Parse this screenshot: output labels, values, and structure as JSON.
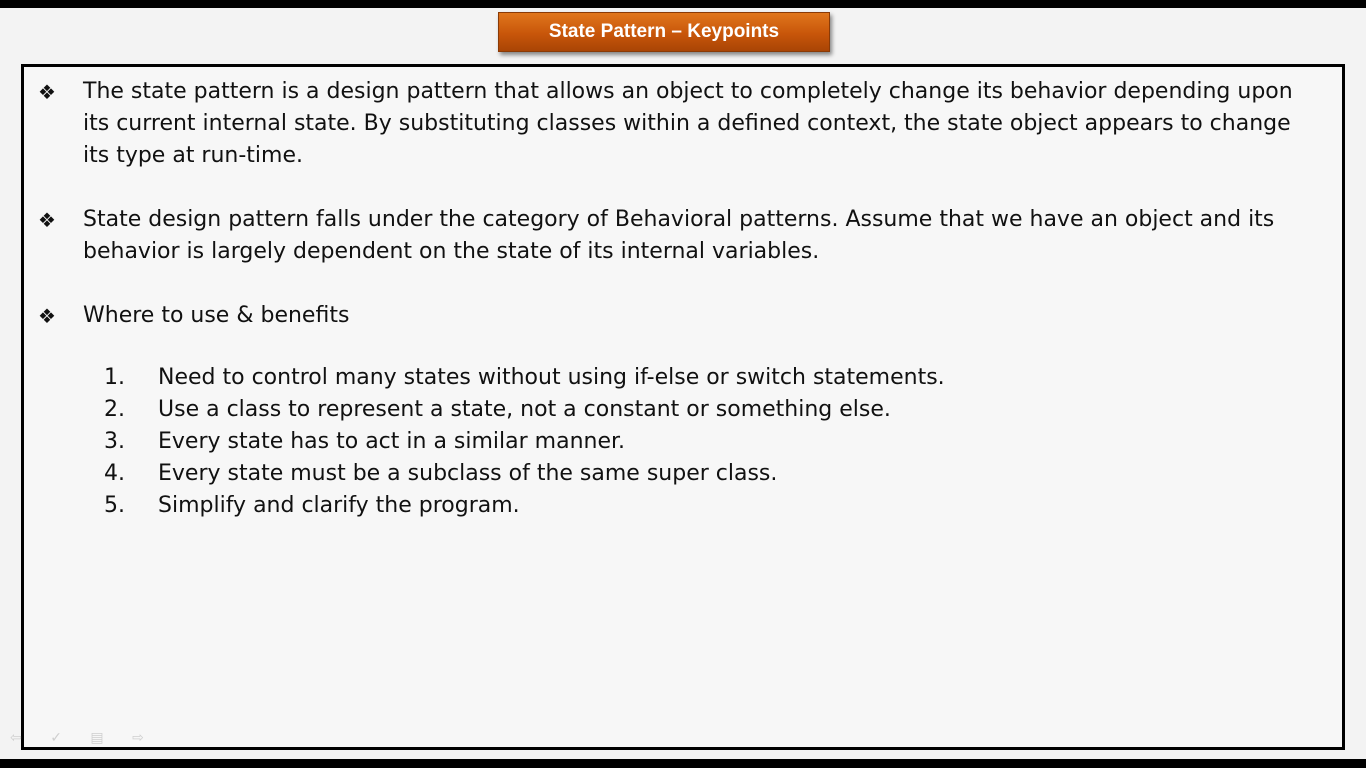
{
  "slide": {
    "title": "State Pattern – Keypoints",
    "bullet_symbol": "❖",
    "bullets": [
      {
        "text": "The state pattern is a design pattern that allows an object to completely change its behavior depending upon its current internal state. By substituting classes within a defined context, the state object appears to change its type at run-time."
      },
      {
        "text": "State design pattern falls under the category of Behavioral patterns. Assume that we have an object and its behavior is largely dependent on the state of its internal variables."
      },
      {
        "text": "Where to use & benefits"
      }
    ],
    "numbered": [
      {
        "num": "1.",
        "text": "Need to control many states without using if-else or switch statements."
      },
      {
        "num": "2.",
        "text": "Use a class to represent a state, not a constant or something else."
      },
      {
        "num": "3.",
        "text": "Every state has to act in a similar manner."
      },
      {
        "num": "4.",
        "text": "Every state must be a subclass of the same super class."
      },
      {
        "num": "5.",
        "text": "Simplify and clarify the program."
      }
    ]
  },
  "nav": {
    "icons": [
      "prev-arrow-icon",
      "pen-icon",
      "menu-icon",
      "next-arrow-icon"
    ],
    "glyphs": {
      "prev": "⇦",
      "pen": "✓",
      "menu": "▤",
      "next": "⇨"
    }
  },
  "colors": {
    "banner": "#c8560a",
    "banner_text": "#ffffff",
    "border": "#000000",
    "background": "#f3f3f3"
  }
}
